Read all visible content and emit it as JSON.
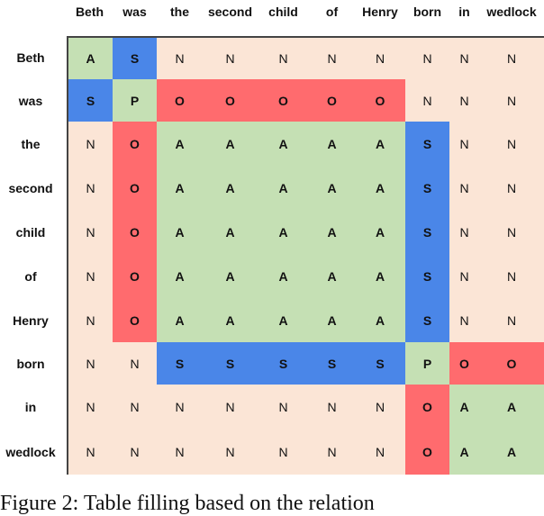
{
  "columns": [
    "Beth",
    "was",
    "the",
    "second",
    "child",
    "of",
    "Henry",
    "born",
    "in",
    "wedlock"
  ],
  "rows": [
    "Beth",
    "was",
    "the",
    "second",
    "child",
    "of",
    "Henry",
    "born",
    "in",
    "wedlock"
  ],
  "matrix": [
    [
      "A",
      "S",
      "N",
      "N",
      "N",
      "N",
      "N",
      "N",
      "N",
      "N"
    ],
    [
      "S",
      "P",
      "O",
      "O",
      "O",
      "O",
      "O",
      "N",
      "N",
      "N"
    ],
    [
      "N",
      "O",
      "A",
      "A",
      "A",
      "A",
      "A",
      "S",
      "N",
      "N"
    ],
    [
      "N",
      "O",
      "A",
      "A",
      "A",
      "A",
      "A",
      "S",
      "N",
      "N"
    ],
    [
      "N",
      "O",
      "A",
      "A",
      "A",
      "A",
      "A",
      "S",
      "N",
      "N"
    ],
    [
      "N",
      "O",
      "A",
      "A",
      "A",
      "A",
      "A",
      "S",
      "N",
      "N"
    ],
    [
      "N",
      "O",
      "A",
      "A",
      "A",
      "A",
      "A",
      "S",
      "N",
      "N"
    ],
    [
      "N",
      "N",
      "S",
      "S",
      "S",
      "S",
      "S",
      "P",
      "O",
      "O"
    ],
    [
      "N",
      "N",
      "N",
      "N",
      "N",
      "N",
      "N",
      "O",
      "A",
      "A"
    ],
    [
      "N",
      "N",
      "N",
      "N",
      "N",
      "N",
      "N",
      "O",
      "A",
      "A"
    ]
  ],
  "colors": {
    "N": "#FBE5D6",
    "A": "#C5E0B4",
    "P": "#C5E0B4",
    "S": "#4A86E8",
    "O": "#FF6B6E"
  },
  "caption": "Figure 2: Table filling based on the relation"
}
